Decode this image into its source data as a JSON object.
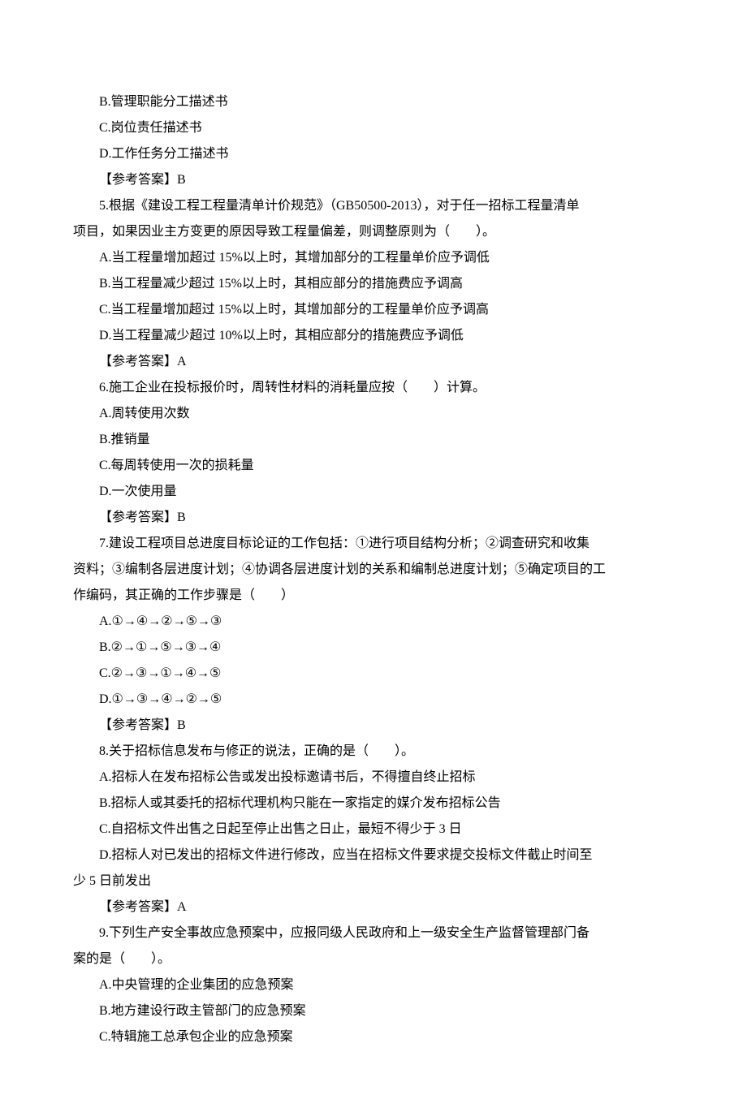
{
  "partialOptions": {
    "b": "B.管理职能分工描述书",
    "c": "C.岗位责任描述书",
    "d": "D.工作任务分工描述书"
  },
  "partialAnswer": "【参考答案】B",
  "q5": {
    "stem1": "5.根据《建设工程工程量清单计价规范》（GB50500-2013），对于任一招标工程量清单",
    "stem2": "项目，如果因业主方变更的原因导致工程量偏差，则调整原则为（　　）。",
    "a": "A.当工程量增加超过 15%以上时，其增加部分的工程量单价应予调低",
    "b": "B.当工程量减少超过 15%以上时，其相应部分的措施费应予调高",
    "c": "C.当工程量增加超过 15%以上时，其增加部分的工程量单价应予调高",
    "d": "D.当工程量减少超过 10%以上时，其相应部分的措施费应予调低",
    "answer": "【参考答案】A"
  },
  "q6": {
    "stem": "6.施工企业在投标报价时，周转性材料的消耗量应按（　　）计算。",
    "a": "A.周转使用次数",
    "b": "B.推销量",
    "c": "C.每周转使用一次的损耗量",
    "d": "D.一次使用量",
    "answer": "【参考答案】B"
  },
  "q7": {
    "stem1": "7.建设工程项目总进度目标论证的工作包括：①进行项目结构分析；②调查研究和收集",
    "stem2": "资料；③编制各层进度计划；④协调各层进度计划的关系和编制总进度计划；⑤确定项目的工",
    "stem3": "作编码，其正确的工作步骤是（　　）",
    "a": "A.①→④→②→⑤→③",
    "b": "B.②→①→⑤→③→④",
    "c": "C.②→③→①→④→⑤",
    "d": "D.①→③→④→②→⑤",
    "answer": "【参考答案】B"
  },
  "q8": {
    "stem": "8.关于招标信息发布与修正的说法，正确的是（　　）。",
    "a": "A.招标人在发布招标公告或发出投标邀请书后，不得擅自终止招标",
    "b": "B.招标人或其委托的招标代理机构只能在一家指定的媒介发布招标公告",
    "c": "C.自招标文件出售之日起至停止出售之日止，最短不得少于 3 日",
    "d1": "D.招标人对已发出的招标文件进行修改，应当在招标文件要求提交投标文件截止时间至",
    "d2": "少 5 日前发出",
    "answer": "【参考答案】A"
  },
  "q9": {
    "stem1": "9.下列生产安全事故应急预案中，应报同级人民政府和上一级安全生产监督管理部门备",
    "stem2": "案的是（　　）。",
    "a": "A.中央管理的企业集团的应急预案",
    "b": "B.地方建设行政主管部门的应急预案",
    "c": "C.特辑施工总承包企业的应急预案"
  }
}
